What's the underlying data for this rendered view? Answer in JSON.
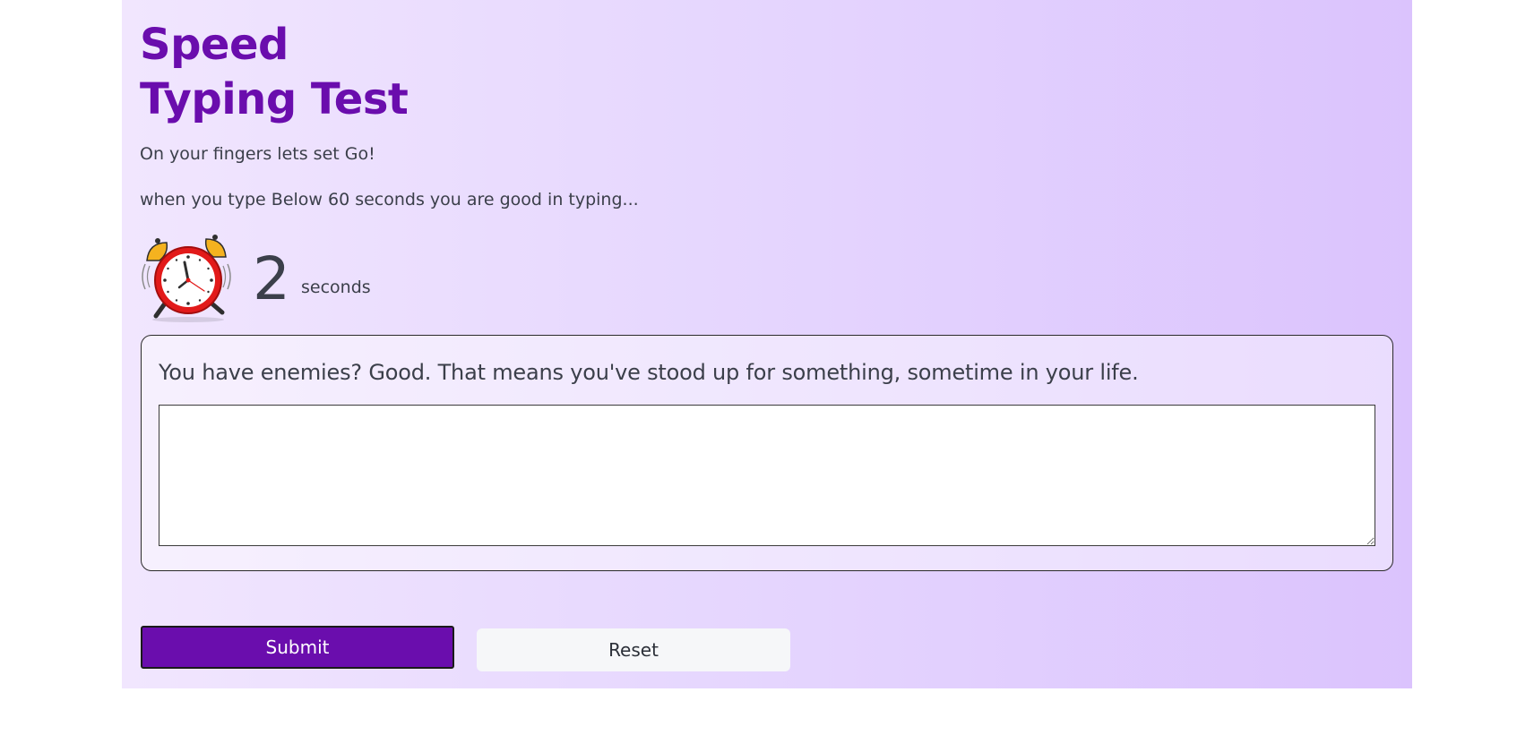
{
  "header": {
    "title_line1": "Speed",
    "title_line2": "Typing Test",
    "subtitle1": "On your fingers lets set Go!",
    "subtitle2": "when you type Below 60 seconds you are good in typing..."
  },
  "timer": {
    "icon": "alarm-clock-icon",
    "value": "2",
    "unit": "seconds"
  },
  "test": {
    "quote": "You have enemies? Good. That means you've stood up for something, sometime in your life.",
    "input_value": "",
    "input_placeholder": ""
  },
  "actions": {
    "submit_label": "Submit",
    "reset_label": "Reset"
  },
  "colors": {
    "accent": "#6a0dad",
    "text": "#3b3f4a",
    "background_start": "#f1e6fe",
    "background_end": "#dbc3fd",
    "reset_bg": "#f6f7f9"
  }
}
